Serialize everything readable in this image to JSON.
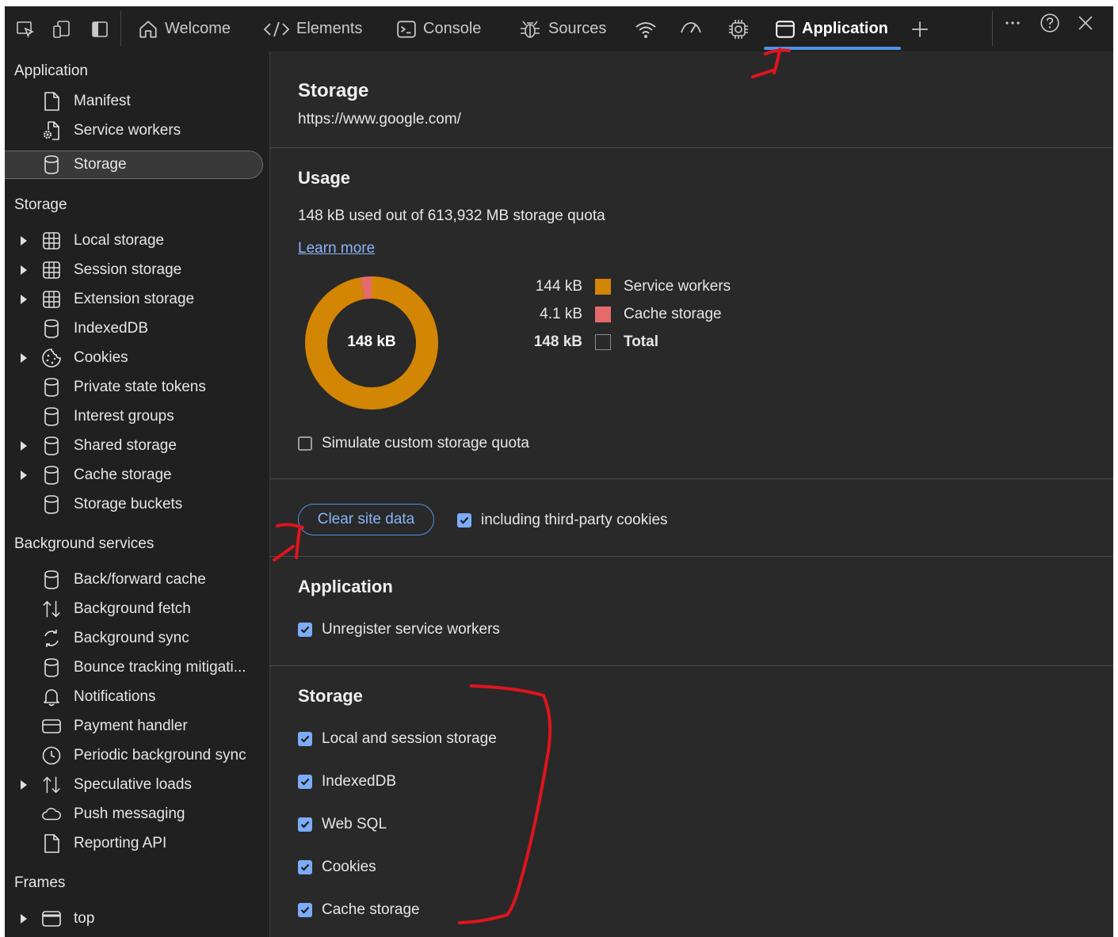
{
  "toolbar": {
    "tabs": [
      {
        "label": "Welcome",
        "icon": "home-icon"
      },
      {
        "label": "Elements",
        "icon": "code-icon"
      },
      {
        "label": "Console",
        "icon": "console-icon"
      },
      {
        "label": "Sources",
        "icon": "bug-icon"
      },
      {
        "label": "Application",
        "icon": "application-icon"
      }
    ],
    "active_tab": "Application",
    "accent_color": "#4b95e8"
  },
  "sidebar": {
    "application_title": "Application",
    "application_items": [
      {
        "label": "Manifest",
        "icon": "file-icon"
      },
      {
        "label": "Service workers",
        "icon": "gear-file-icon"
      },
      {
        "label": "Storage",
        "icon": "database-icon",
        "selected": true
      }
    ],
    "storage_title": "Storage",
    "storage_items": [
      {
        "label": "Local storage",
        "icon": "grid-icon",
        "expandable": true
      },
      {
        "label": "Session storage",
        "icon": "grid-icon",
        "expandable": true
      },
      {
        "label": "Extension storage",
        "icon": "grid-icon",
        "expandable": true
      },
      {
        "label": "IndexedDB",
        "icon": "database-icon",
        "expandable": false
      },
      {
        "label": "Cookies",
        "icon": "cookie-icon",
        "expandable": true
      },
      {
        "label": "Private state tokens",
        "icon": "database-icon",
        "expandable": false
      },
      {
        "label": "Interest groups",
        "icon": "database-icon",
        "expandable": false
      },
      {
        "label": "Shared storage",
        "icon": "database-icon",
        "expandable": true
      },
      {
        "label": "Cache storage",
        "icon": "database-icon",
        "expandable": true
      },
      {
        "label": "Storage buckets",
        "icon": "database-icon",
        "expandable": false
      }
    ],
    "background_title": "Background services",
    "background_items": [
      {
        "label": "Back/forward cache",
        "icon": "database-icon",
        "expandable": false
      },
      {
        "label": "Background fetch",
        "icon": "up-down-arrows-icon",
        "expandable": false
      },
      {
        "label": "Background sync",
        "icon": "sync-icon",
        "expandable": false
      },
      {
        "label": "Bounce tracking mitigati...",
        "icon": "database-icon",
        "expandable": false
      },
      {
        "label": "Notifications",
        "icon": "bell-icon",
        "expandable": false
      },
      {
        "label": "Payment handler",
        "icon": "card-icon",
        "expandable": false
      },
      {
        "label": "Periodic background sync",
        "icon": "clock-icon",
        "expandable": false
      },
      {
        "label": "Speculative loads",
        "icon": "up-down-arrows-icon",
        "expandable": true
      },
      {
        "label": "Push messaging",
        "icon": "cloud-icon",
        "expandable": false
      },
      {
        "label": "Reporting API",
        "icon": "file-icon",
        "expandable": false
      }
    ],
    "frames_title": "Frames",
    "frames_items": [
      {
        "label": "top",
        "icon": "frame-icon",
        "expandable": true
      }
    ]
  },
  "main": {
    "title": "Storage",
    "origin": "https://www.google.com/",
    "usage": {
      "title": "Usage",
      "summary": "148 kB used out of 613,932 MB storage quota",
      "learn_more": "Learn more",
      "donut_center": "148 kB",
      "legend": [
        {
          "value": "144 kB",
          "label": "Service workers",
          "color": "#d38504",
          "fraction": 0.973
        },
        {
          "value": "4.1 kB",
          "label": "Cache storage",
          "color": "#e56b6b",
          "fraction": 0.027
        },
        {
          "value": "148 kB",
          "label": "Total",
          "color": "transparent",
          "bold": true
        }
      ],
      "simulate_label": "Simulate custom storage quota",
      "simulate_checked": false
    },
    "clear": {
      "button_label": "Clear site data",
      "third_party_label": "including third-party cookies",
      "third_party_checked": true
    },
    "application": {
      "title": "Application",
      "items": [
        {
          "label": "Unregister service workers",
          "checked": true
        }
      ]
    },
    "storage": {
      "title": "Storage",
      "items": [
        {
          "label": "Local and session storage",
          "checked": true
        },
        {
          "label": "IndexedDB",
          "checked": true
        },
        {
          "label": "Web SQL",
          "checked": true
        },
        {
          "label": "Cookies",
          "checked": true
        },
        {
          "label": "Cache storage",
          "checked": true
        }
      ]
    }
  },
  "annotation_color": "#e0141e"
}
